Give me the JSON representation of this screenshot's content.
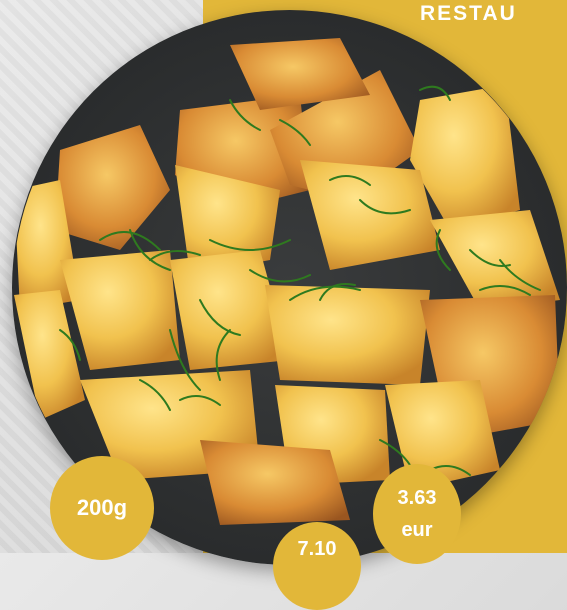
{
  "header": {
    "brand": "RESTAU"
  },
  "badges": {
    "weight": "200g",
    "price_value": "3.63",
    "price_unit": "eur",
    "secondary_price": "7.10"
  },
  "colors": {
    "accent": "#e2b739",
    "plate": "#2a2c2d"
  },
  "image": {
    "subject": "potato-icon"
  }
}
